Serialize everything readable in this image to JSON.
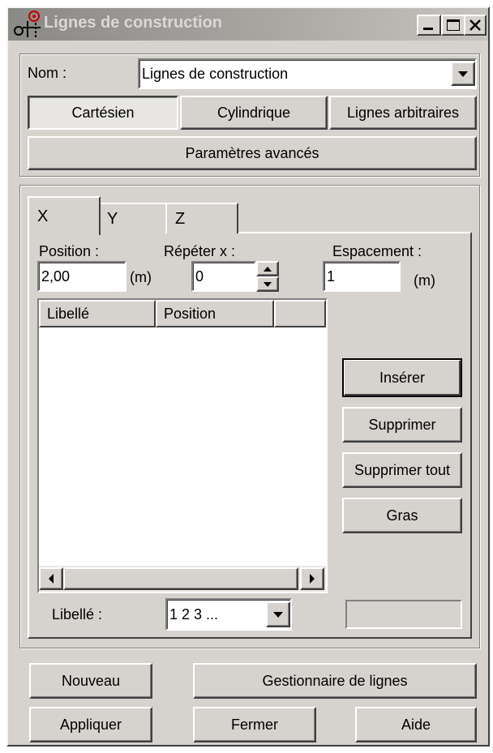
{
  "window": {
    "title": "Lignes de construction",
    "minimize_icon": "minimize-icon",
    "maximize_icon": "maximize-icon",
    "close_icon": "close-icon"
  },
  "nom": {
    "label": "Nom :",
    "value": "Lignes de construction"
  },
  "modes": [
    {
      "label": "Cartésien",
      "selected": true
    },
    {
      "label": "Cylindrique",
      "selected": false
    },
    {
      "label": "Lignes arbitraires",
      "selected": false
    }
  ],
  "advanced_button": "Paramètres avancés",
  "tabs": [
    {
      "label": "X",
      "active": true
    },
    {
      "label": "Y",
      "active": false
    },
    {
      "label": "Z",
      "active": false
    }
  ],
  "fields": {
    "position": {
      "label": "Position :",
      "value": "2,00",
      "unit": "(m)"
    },
    "repeat": {
      "label": "Répéter x :",
      "value": "0"
    },
    "spacing": {
      "label": "Espacement :",
      "value": "1",
      "unit": "(m)"
    }
  },
  "table": {
    "columns": [
      "Libellé",
      "Position",
      ""
    ],
    "rows": []
  },
  "side_buttons": {
    "insert": "Insérer",
    "delete": "Supprimer",
    "delete_all": "Supprimer tout",
    "bold": "Gras"
  },
  "label_select": {
    "label": "Libellé :",
    "value": "1 2 3 ..."
  },
  "bottom_buttons": {
    "new": "Nouveau",
    "manager": "Gestionnaire de lignes",
    "apply": "Appliquer",
    "close": "Fermer",
    "help": "Aide"
  }
}
